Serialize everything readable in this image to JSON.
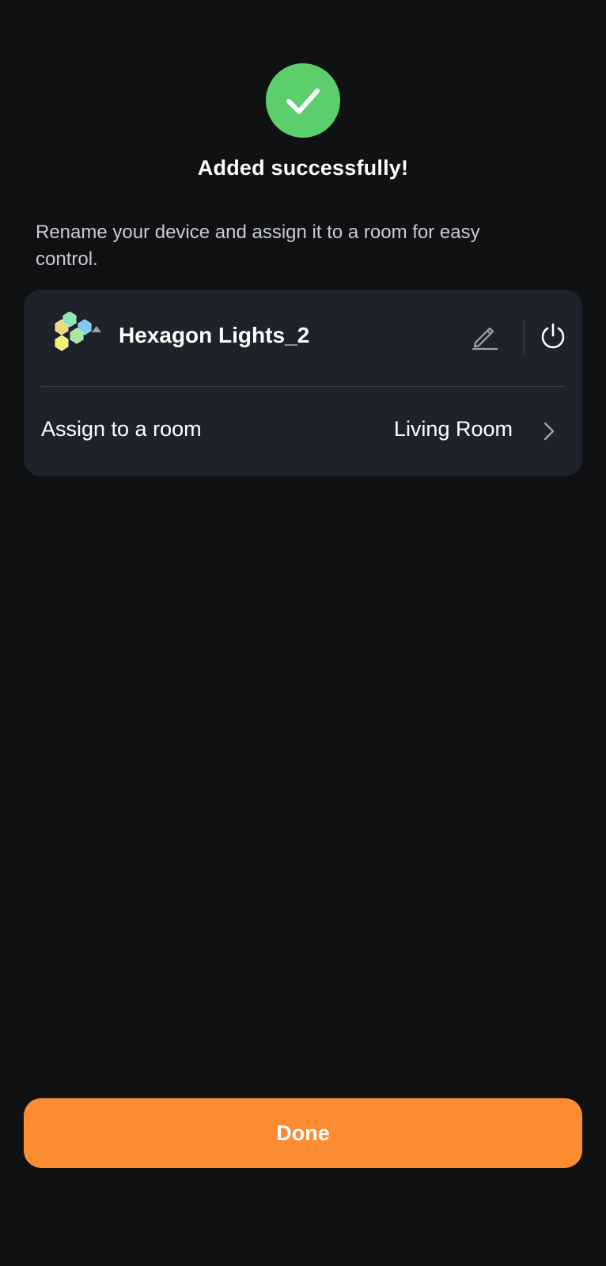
{
  "header": {
    "status_icon": "checkmark-icon",
    "title": "Added successfully!"
  },
  "instruction": "Rename your device and assign it to a room for easy control.",
  "device": {
    "name": "Hexagon Lights_2",
    "thumbnail_icon": "hexagon-lights-icon",
    "edit_icon": "pencil-icon",
    "power_icon": "power-icon"
  },
  "room": {
    "label": "Assign to a room",
    "value": "Living Room",
    "chevron_icon": "chevron-right-icon"
  },
  "actions": {
    "done_label": "Done"
  },
  "colors": {
    "background": "#0f1113",
    "card": "#1e232b",
    "success": "#5ccf6c",
    "accent": "#fb8c32"
  }
}
